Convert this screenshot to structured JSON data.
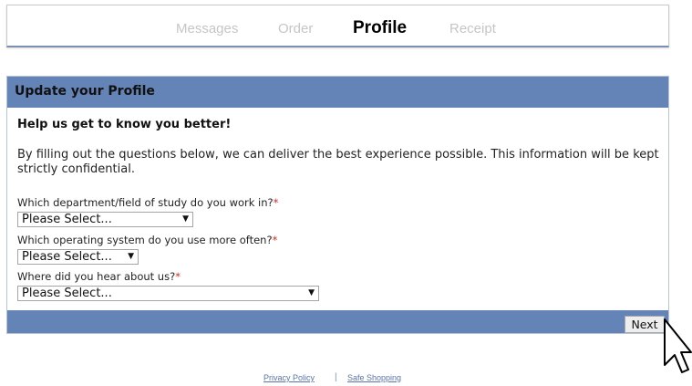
{
  "steps": {
    "messages": "Messages",
    "order": "Order",
    "profile": "Profile",
    "receipt": "Receipt"
  },
  "panel": {
    "title": "Update your Profile",
    "subheading": "Help us get to know you better!",
    "intro": "By filling out the questions below, we can deliver the best experience possible. This information will be kept strictly confidential."
  },
  "questions": {
    "department": {
      "label": "Which department/field of study do you work in?",
      "required_mark": "*",
      "selected": "Please Select..."
    },
    "os": {
      "label": "Which operating system do you use more often?",
      "required_mark": "*",
      "selected": "Please Select..."
    },
    "referral": {
      "label": "Where did you hear about us?",
      "required_mark": "*",
      "selected": "Please Select..."
    }
  },
  "buttons": {
    "next": "Next"
  },
  "footer": {
    "privacy": "Privacy Policy",
    "separator": "|",
    "safe_shopping": "Safe Shopping"
  },
  "colors": {
    "panel_header": "#6483b7",
    "required": "#d52b1e",
    "link": "#5a74a8"
  },
  "icons": {
    "dropdown": "caret-down-icon",
    "pointer": "mouse-cursor-icon"
  }
}
